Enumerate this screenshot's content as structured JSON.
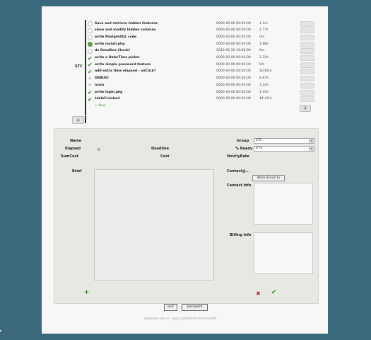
{
  "group": {
    "label": "STC"
  },
  "tasks": [
    {
      "icon": "empty-icon",
      "name": "Save and retrieve hidden features",
      "deadline": "0000-00-00 00:00:00",
      "elapsed": "1.2m"
    },
    {
      "icon": "empty-icon",
      "name": "show and modify hidden columns",
      "deadline": "0000-00-00 00:00:00",
      "elapsed": "2.77h"
    },
    {
      "icon": "empty-icon",
      "name": "write PostgreSQL code",
      "deadline": "0000-00-00 00:00:00",
      "elapsed": "0m"
    },
    {
      "icon": "green-dot-icon",
      "name": "write install.php",
      "deadline": "0000-00-00 00:00:00",
      "elapsed": "1.98h"
    },
    {
      "icon": "empty-icon",
      "name": "do Deadline Check!",
      "deadline": "2010-06-20 18:00:00",
      "elapsed": "0m"
    },
    {
      "icon": "check-icon",
      "name": "write a Date/Time picker",
      "deadline": "0000-00-00 00:00:00",
      "elapsed": "2.21h"
    },
    {
      "icon": "check-icon",
      "name": "write simple password feature",
      "deadline": "0000-00-00 00:00:00",
      "elapsed": "0m"
    },
    {
      "icon": "check-icon",
      "name": "add extra time elapsed - onClick?",
      "deadline": "0000-00-00 00:00:00",
      "elapsed": "30.80m"
    },
    {
      "icon": "star-icon",
      "name": "DEBUG!",
      "deadline": "0000-00-00 00:00:00",
      "elapsed": "6.67h"
    },
    {
      "icon": "star-icon",
      "name": "icons",
      "deadline": "0000-00-00 00:00:00",
      "elapsed": "3.33h"
    },
    {
      "icon": "check-icon",
      "name": "write login.php",
      "deadline": "0000-00-00 00:00:00",
      "elapsed": "1.44h"
    },
    {
      "icon": "check-icon",
      "name": "tableFinished",
      "deadline": "0000-00-00 00:00:00",
      "elapsed": "44.42m"
    }
  ],
  "add_task_label": "+ New",
  "detail": {
    "name_label": "Name",
    "elapsed_label": "Elapsed",
    "elapsed_value": "0",
    "deadline_label": "Deadline",
    "sumcost_label": "SumCost",
    "cost_label": "Cost",
    "brief_label": "Brief",
    "group_label": "Group",
    "group_value": "STC",
    "ready_label": "% Ready",
    "ready_value": "0 %",
    "hourly_label": "HourlyRate",
    "contact_label": "Contact@...",
    "write_email_label": "Write Email to",
    "contact_info_label": "Contact info",
    "billing_info_label": "Billing info"
  },
  "buttons": {
    "exit_label": "exit",
    "password_label": "password"
  },
  "footer": "webfolder.net v2 · spm_csa/#f/##/nr/##/rev/#8"
}
